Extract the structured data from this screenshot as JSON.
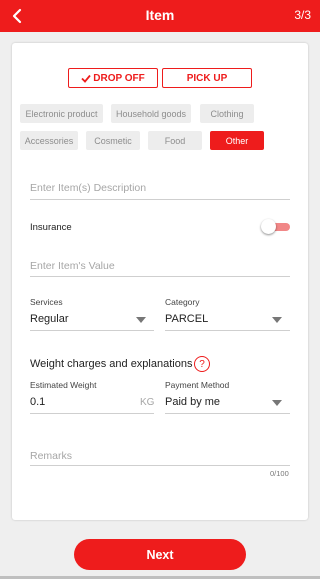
{
  "header": {
    "title": "Item",
    "step": "3/3",
    "back_icon": "chevron-left-icon"
  },
  "delivery_modes": [
    {
      "label": "DROP OFF",
      "selected": true,
      "icon": "check-icon"
    },
    {
      "label": "PICK UP",
      "selected": false
    }
  ],
  "categories": [
    {
      "label": "Electronic product",
      "active": false
    },
    {
      "label": "Household goods",
      "active": false
    },
    {
      "label": "Clothing",
      "active": false
    },
    {
      "label": "Accessories",
      "active": false
    },
    {
      "label": "Cosmetic",
      "active": false
    },
    {
      "label": "Food",
      "active": false
    },
    {
      "label": "Other",
      "active": true
    }
  ],
  "form": {
    "description_placeholder": "Enter Item(s) Description",
    "insurance_label": "Insurance",
    "insurance_enabled": false,
    "value_placeholder": "Enter Item's Value",
    "services_label": "Services",
    "services_value": "Regular",
    "category_label": "Category",
    "category_value": "PARCEL",
    "weight_section_title": "Weight charges and explanations",
    "help_icon_glyph": "?",
    "weight_label": "Estimated Weight",
    "weight_value": "0.1",
    "weight_unit": "KG",
    "payment_label": "Payment Method",
    "payment_value": "Paid by me",
    "remarks_placeholder": "Remarks",
    "remarks_counter": "0/100"
  },
  "footer": {
    "next_label": "Next"
  },
  "colors": {
    "accent": "#ee1c1c",
    "chip_bg": "#ededed",
    "background": "#efefef"
  }
}
